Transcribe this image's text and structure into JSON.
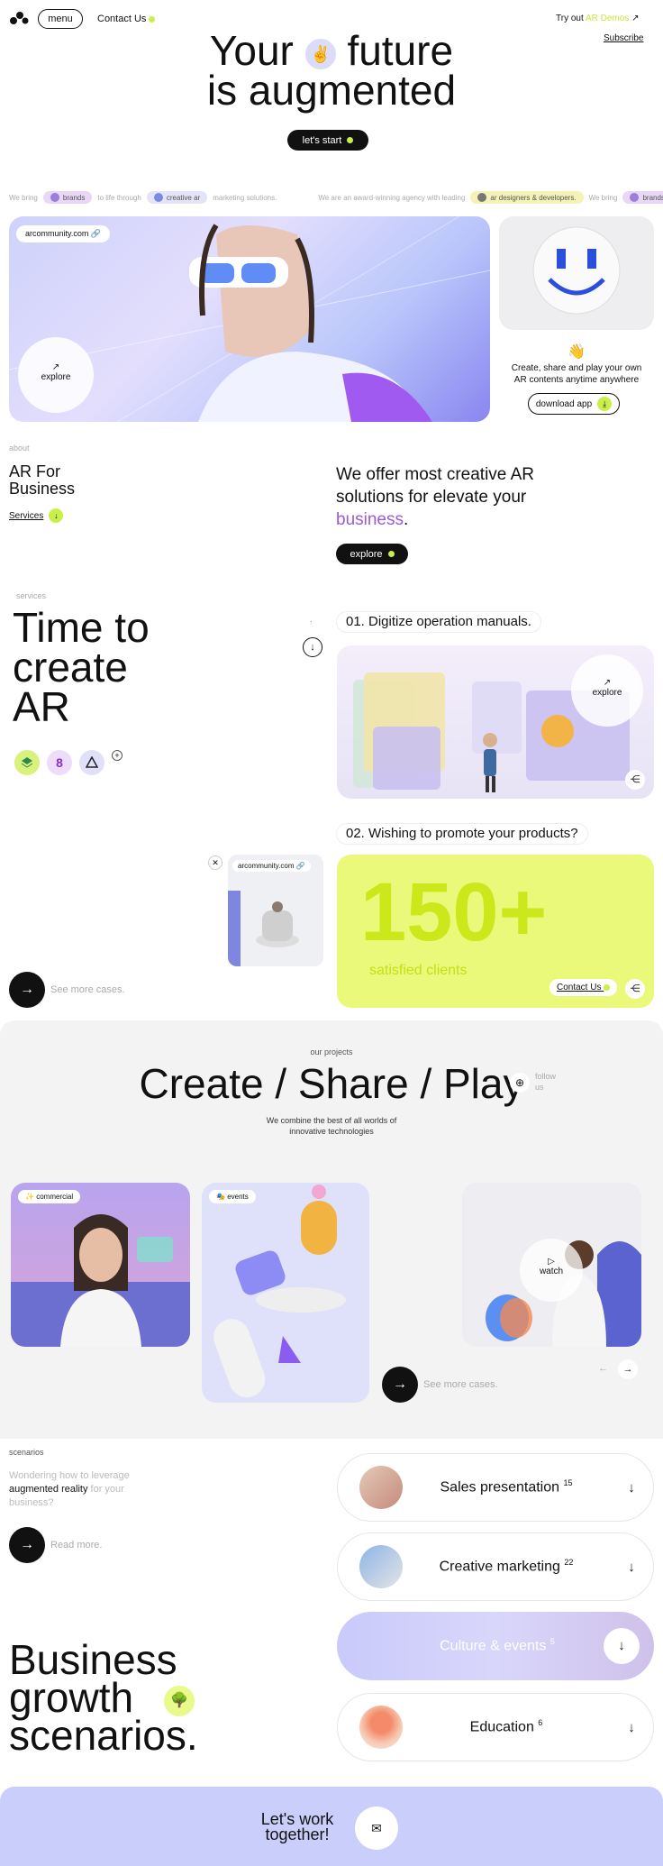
{
  "header": {
    "menu": "menu",
    "contact": "Contact Us",
    "try_out": "Try out",
    "demos": "AR Demos",
    "subscribe": "Subscribe"
  },
  "hero": {
    "title_1a": "Your",
    "title_1b": "future",
    "title_2": "is augmented",
    "emoji": "✌",
    "start": "let's start"
  },
  "ticker": {
    "t1": "We bring",
    "brands": "brands",
    "t2": "to life through",
    "creative": "creative ar",
    "t3": "marketing solutions.",
    "t4": "We are an award-winning agency with leading",
    "designers": "ar designers & developers.",
    "t5": "We bring",
    "brands2": "brands"
  },
  "feature": {
    "url": "arcommunity.com",
    "explore": "explore",
    "hand": "👋",
    "text": "Create, share and play your own AR contents anytime anywhere",
    "download": "download app"
  },
  "about": {
    "label": "about",
    "title": "AR For Business",
    "services": "Services",
    "text_1": "We offer most creative AR solutions for elevate your",
    "text_hl": "business",
    "explore": "explore"
  },
  "services": {
    "label": "services",
    "title": "Time to create AR",
    "item1": "01. Digitize operation manuals.",
    "explore": "explore",
    "item2": "02. Wishing to promote your products?",
    "url": "arcommunity.com",
    "big": "150+",
    "satisfied": "satisfied clients",
    "contact": "Contact Us",
    "more": "See more cases."
  },
  "projects": {
    "label": "our projects",
    "title": "Create / Share / Play",
    "follow": "follow us",
    "sub": "We combine the best of all worlds of innovative technologies",
    "tag1": "commercial",
    "tag2": "events",
    "watch": "watch",
    "more": "See more cases."
  },
  "scenarios": {
    "label": "scenarios",
    "q1": "Wondering how to leverage",
    "q_hl": "augmented reality",
    "q2": "for your business?",
    "read": "Read more.",
    "title": "Business growth scenarios.",
    "items": [
      {
        "label": "Sales presentation",
        "n": "15"
      },
      {
        "label": "Creative marketing",
        "n": "22"
      },
      {
        "label": "Culture & events",
        "n": "5"
      },
      {
        "label": "Education",
        "n": "6"
      }
    ]
  },
  "footer": {
    "cta": "Let's work together!",
    "mail": "✉"
  }
}
